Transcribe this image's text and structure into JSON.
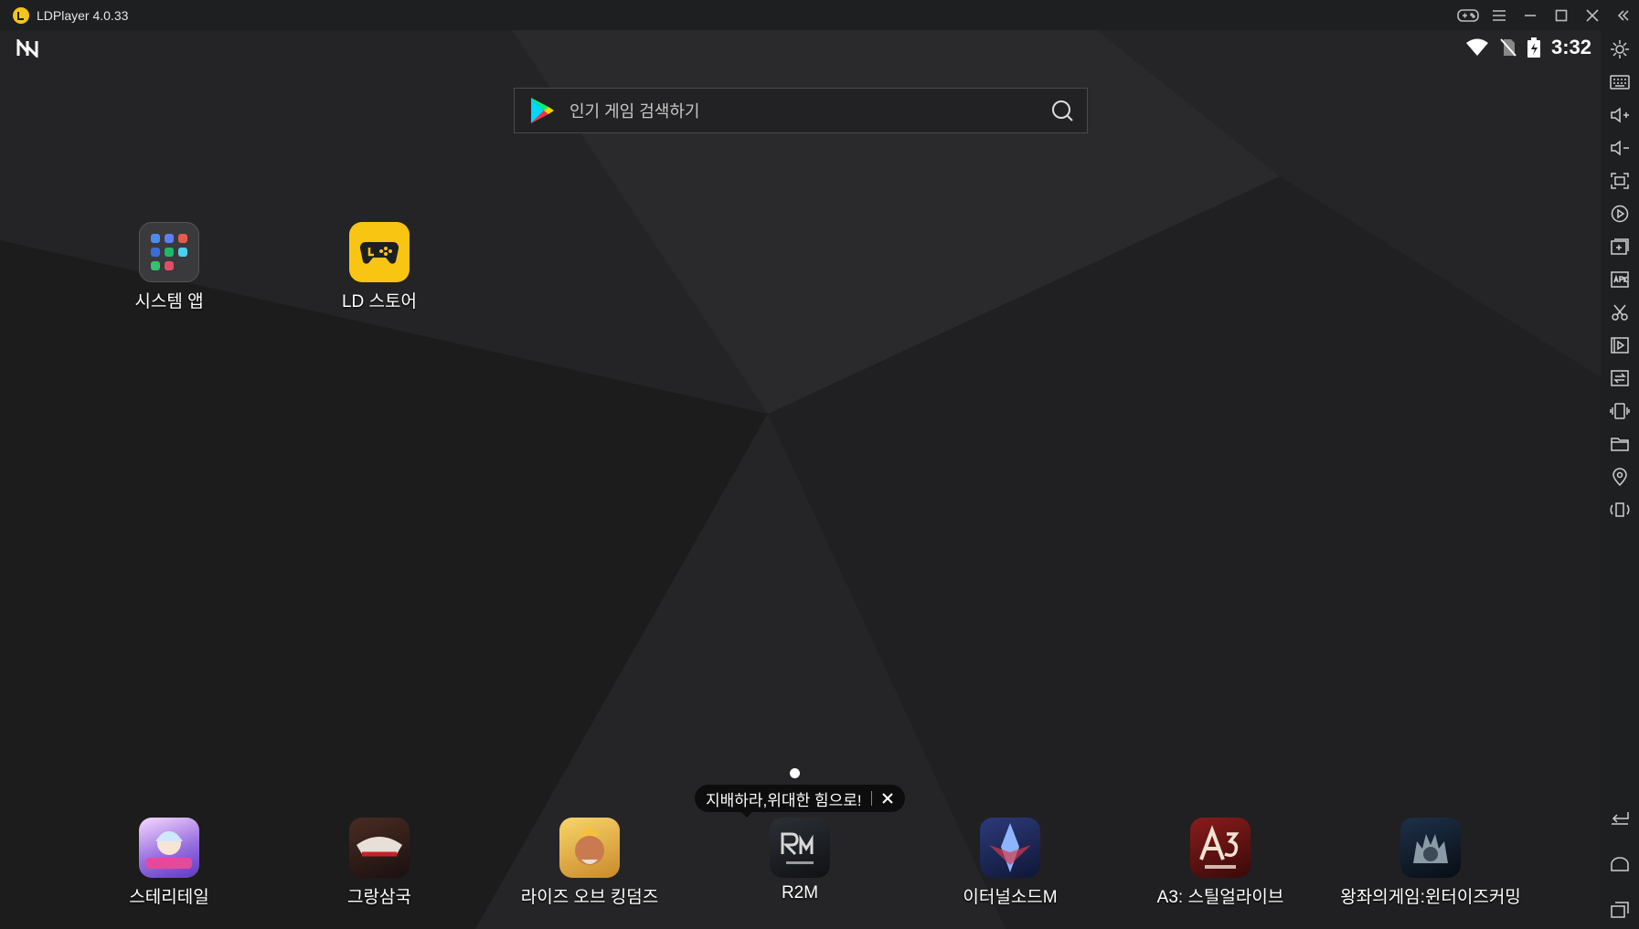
{
  "window": {
    "title": "LDPlayer 4.0.33"
  },
  "status": {
    "time": "3:32"
  },
  "search": {
    "placeholder": "인기 게임 검색하기"
  },
  "desktop": {
    "apps": [
      {
        "label": "시스템 앱"
      },
      {
        "label": "LD 스토어"
      }
    ]
  },
  "tooltip": {
    "text": "지배하라,위대한 힘으로!"
  },
  "dock": {
    "apps": [
      {
        "label": "스테리테일"
      },
      {
        "label": "그랑삼국"
      },
      {
        "label": "라이즈 오브 킹덤즈"
      },
      {
        "label": "R2M"
      },
      {
        "label": "이터널소드M"
      },
      {
        "label": "A3: 스틸얼라이브"
      },
      {
        "label": "왕좌의게임:윈터이즈커밍"
      }
    ]
  },
  "colors": {
    "accent": "#f9c513",
    "titlebar": "#1e1f21",
    "screen": "#1b1b1c"
  }
}
